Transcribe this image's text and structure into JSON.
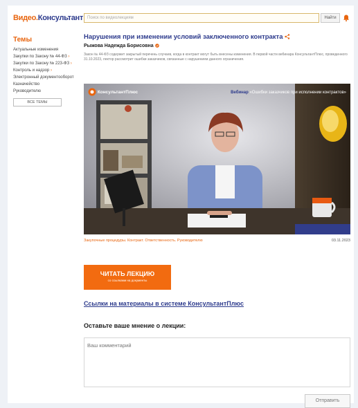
{
  "header": {
    "logo_part1": "Видео.",
    "logo_part2": "Консультант",
    "search_placeholder": "Поиск по видеолекциям",
    "search_button": "Найти"
  },
  "sidebar": {
    "title": "Темы",
    "items": [
      {
        "label": "Актуальные изменения"
      },
      {
        "label": "Закупки по Закону № 44-ФЗ",
        "marker": "›"
      },
      {
        "label": "Закупки по Закону № 223-ФЗ",
        "marker": "›"
      },
      {
        "label": "Контроль и надзор",
        "marker": "›"
      },
      {
        "label": "Электронный документооборот"
      },
      {
        "label": "Казначейство"
      },
      {
        "label": "Руководителю"
      }
    ],
    "all_topics_button": "ВСЕ ТЕМЫ"
  },
  "lecture": {
    "title": "Нарушения при изменении условий заключенного контракта",
    "author": "Рыжова Надежда Борисовна",
    "description": "Закон № 44-ФЗ содержит закрытый перечень случаев, когда в контракт могут быть внесены изменения. В первой части вебинара КонсультантПлюс, проведенного 31.10.2023, лектор рассмотрит ошибки заказчиков, связанные с нарушением данного ограничения.",
    "video": {
      "brand": "КонсультантПлюс",
      "webinar_label": "Вебинар",
      "webinar_title": "«Ошибки заказчиков при исполнении контрактов»"
    },
    "tags": "Закупочные процедуры. Контракт. Ответственность. Руководителю",
    "date": "03.11.2023",
    "read_button_line1": "ЧИТАТЬ ЛЕКЦИЮ",
    "read_button_line2": "со ссылками на документы",
    "materials_link": "Ссылки на материалы в системе КонсультантПлюс",
    "opinion_heading": "Оставьте ваше мнение о лекции:",
    "comment_placeholder": "Ваш комментарий",
    "send_button": "Отправить"
  },
  "colors": {
    "accent": "#e8650f",
    "brand_blue": "#2c3a8c",
    "button_orange": "#f26b10"
  },
  "icons": [
    "bell-icon",
    "share-icon",
    "verified-icon",
    "brand-logo-icon"
  ]
}
